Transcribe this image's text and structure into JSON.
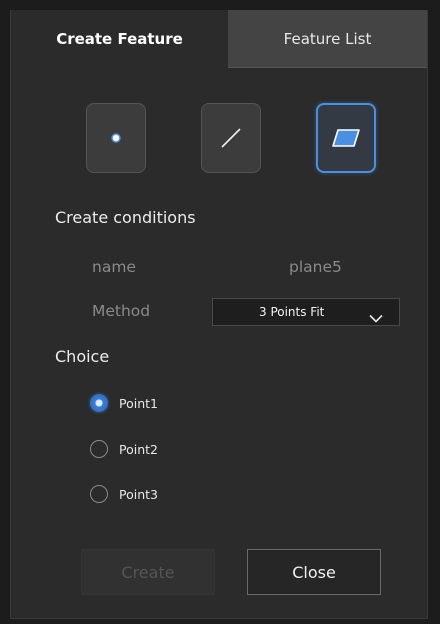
{
  "tabs": [
    {
      "label": "Create Feature",
      "active": true
    },
    {
      "label": "Feature List",
      "active": false
    }
  ],
  "feature_types": [
    {
      "icon": "point-icon",
      "selected": false
    },
    {
      "icon": "line-icon",
      "selected": false
    },
    {
      "icon": "plane-icon",
      "selected": true
    }
  ],
  "conditions": {
    "heading": "Create conditions",
    "name_label": "name",
    "name_value": "plane5",
    "method_label": "Method",
    "method_value": "3 Points Fit"
  },
  "choice": {
    "heading": "Choice",
    "options": [
      {
        "label": "Point1",
        "selected": true
      },
      {
        "label": "Point2",
        "selected": false
      },
      {
        "label": "Point3",
        "selected": false
      }
    ]
  },
  "buttons": {
    "create_label": "Create",
    "create_enabled": false,
    "close_label": "Close"
  },
  "colors": {
    "accent": "#4a90e2",
    "panel_bg": "#2b2b2b",
    "inactive_tab_bg": "#444444"
  }
}
